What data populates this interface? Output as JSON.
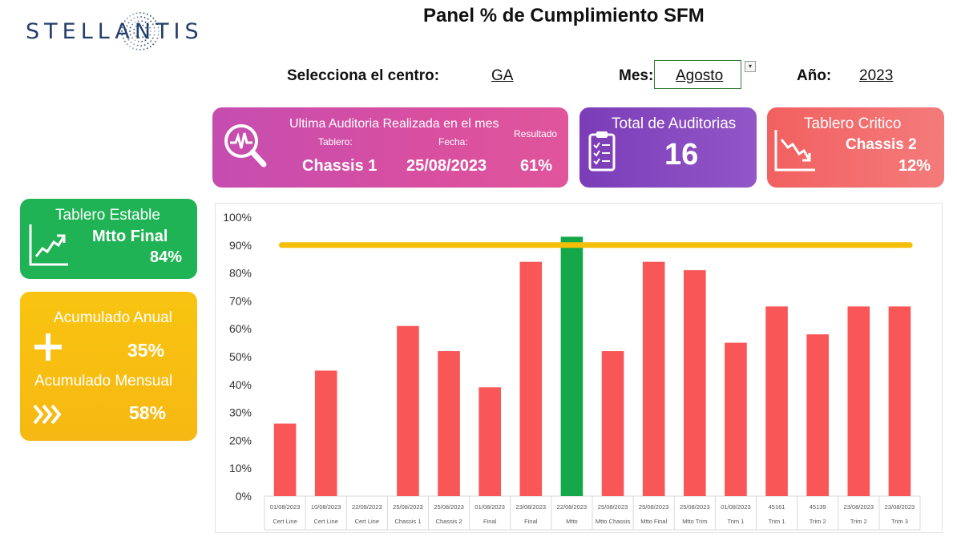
{
  "logo": {
    "text": "STELLANTIS"
  },
  "title": "Panel % de Cumplimiento SFM",
  "filters": {
    "center_label": "Selecciona el centro:",
    "center_value": "GA",
    "month_label": "Mes:",
    "month_value": "Agosto",
    "year_label": "Año:",
    "year_value": "2023"
  },
  "last_audit": {
    "title": "Ultima Auditoria Realizada en el mes",
    "board_label": "Tablero:",
    "date_label": "Fecha:",
    "result_label": "Resultado",
    "board_value": "Chassis 1",
    "date_value": "25/08/2023",
    "result_value": "61%",
    "icon": "magnifier-pulse-icon"
  },
  "total_audits": {
    "title": "Total de Auditorias",
    "value": "16",
    "icon": "clipboard-checklist-icon"
  },
  "critical": {
    "title": "Tablero Critico",
    "board": "Chassis 2",
    "value": "12%",
    "icon": "trend-down-icon"
  },
  "stable": {
    "title": "Tablero Estable",
    "board": "Mtto Final",
    "value": "84%",
    "icon": "trend-up-icon"
  },
  "cumulative": {
    "annual_label": "Acumulado Anual",
    "annual_value": "35%",
    "monthly_label": "Acumulado Mensual",
    "monthly_value": "58%",
    "annual_icon": "plus-icon",
    "monthly_icon": "chevrons-right-icon"
  },
  "colors": {
    "bar_default": "#f95757",
    "bar_highlight": "#14a84a",
    "target_line": "#f5be08"
  },
  "chart_data": {
    "type": "bar",
    "categories": [
      [
        "01/08/2023",
        "Cert Line"
      ],
      [
        "10/08/2023",
        "Cert Line"
      ],
      [
        "22/08/2023",
        "Cert Line"
      ],
      [
        "25/08/2023",
        "Chassis 1"
      ],
      [
        "25/08/2023",
        "Chassis 2"
      ],
      [
        "01/08/2023",
        "Final"
      ],
      [
        "23/08/2023",
        "Final"
      ],
      [
        "22/08/2023",
        "Mtto"
      ],
      [
        "25/08/2023",
        "Mtto Chassis"
      ],
      [
        "25/08/2023",
        "Mtto Final"
      ],
      [
        "25/08/2023",
        "Mtto Trim"
      ],
      [
        "01/08/2023",
        "Trim 1"
      ],
      [
        "45161",
        "Trim 1"
      ],
      [
        "45139",
        "Trim 2"
      ],
      [
        "23/08/2023",
        "Trim 2"
      ],
      [
        "23/08/2023",
        "Trim 3"
      ]
    ],
    "values": [
      26,
      45,
      0,
      61,
      52,
      39,
      84,
      93,
      52,
      84,
      81,
      55,
      68,
      58,
      68,
      68
    ],
    "highlight_index": 7,
    "target": 90,
    "ylim": [
      0,
      100
    ],
    "yticks": [
      "0%",
      "10%",
      "20%",
      "30%",
      "40%",
      "50%",
      "60%",
      "70%",
      "80%",
      "90%",
      "100%"
    ],
    "grid": false
  }
}
